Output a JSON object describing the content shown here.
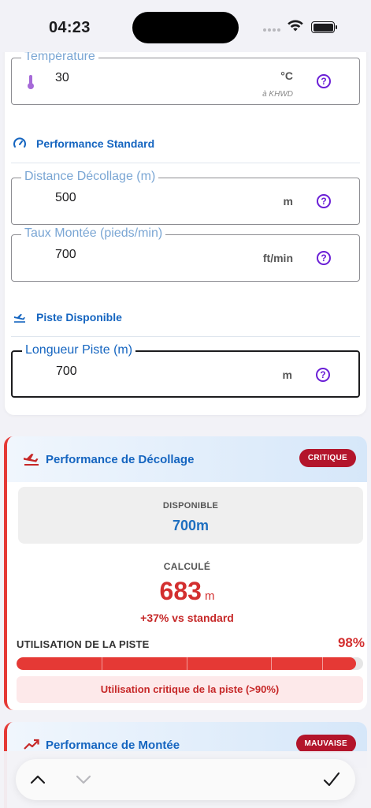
{
  "status_bar": {
    "time": "04:23"
  },
  "temperature": {
    "label": "Température",
    "value": "30",
    "unit": "°C",
    "source": "à KHWD"
  },
  "performance_standard": {
    "title": "Performance Standard"
  },
  "distance_decollage": {
    "label": "Distance Décollage (m)",
    "value": "500",
    "unit": "m"
  },
  "taux_montee": {
    "label": "Taux Montée (pieds/min)",
    "value": "700",
    "unit": "ft/min"
  },
  "piste": {
    "title": "Piste Disponible"
  },
  "longueur_piste": {
    "label": "Longueur Piste (m)",
    "value": "700",
    "unit": "m"
  },
  "help_glyph": "?",
  "takeoff_card": {
    "title": "Performance de Décollage",
    "badge": "CRITIQUE",
    "available_label": "DISPONIBLE",
    "available_value": "700m",
    "calculated_label": "CALCULÉ",
    "calculated_value": "683",
    "calculated_unit": "m",
    "delta": "+37% vs standard",
    "usage_label": "UTILISATION DE LA PISTE",
    "usage_pct": "98%",
    "usage_fraction": 0.98,
    "alert": "Utilisation critique de la piste (>90%)"
  },
  "climb_card": {
    "title": "Performance de Montée",
    "badge": "MAUVAISE"
  },
  "colors": {
    "accent_blue": "#1565c0",
    "critical_red": "#d32f2f",
    "badge_red": "#b3152b",
    "help_purple": "#6a1fd6"
  },
  "toolbar": {
    "icons": [
      "chevron-up-icon",
      "chevron-down-icon",
      "checkmark-icon"
    ]
  }
}
